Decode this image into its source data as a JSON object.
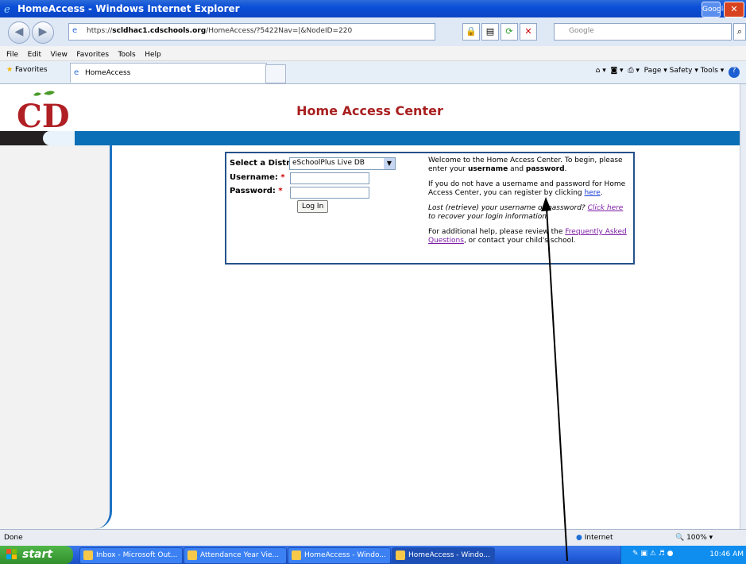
{
  "window": {
    "title": "HomeAccess - Windows Internet Explorer",
    "google_btn": "Google"
  },
  "addressbar": {
    "url_prefix": "https://",
    "url_host": "scldhac1.cdschools.org",
    "url_path": "/HomeAccess/?5422Nav=|&NodeID=220",
    "search_placeholder": "Google"
  },
  "menu": [
    "File",
    "Edit",
    "View",
    "Favorites",
    "Tools",
    "Help"
  ],
  "favorites_bar": {
    "favorites_label": "Favorites",
    "tab_title": "HomeAccess",
    "commands": "Page ▾   Safety ▾   Tools ▾"
  },
  "page": {
    "logo_text": "CD",
    "header_title": "Home Access Center",
    "login": {
      "district_label": "Select a District:",
      "district_value": "eSchoolPlus Live DB",
      "username_label": "Username:",
      "password_label": "Password:",
      "required_marker": "*",
      "login_button": "Log In"
    },
    "info": {
      "p1_a": "Welcome to the Home Access Center. To begin, please enter your ",
      "p1_username": "username",
      "p1_and": " and ",
      "p1_password": "password",
      "p1_end": ".",
      "p2_a": "If you do not have a username and password for Home Access Center, you can register by clicking ",
      "p2_link": "here",
      "p2_end": ".",
      "p3_a": "Lost (retrieve) your username or password? ",
      "p3_link": "Click here",
      "p3_end": " to recover your login information.",
      "p4_a": "For additional help, please review the ",
      "p4_link": "Frequently Asked Questions",
      "p4_end": ", or contact your child's school."
    }
  },
  "statusbar": {
    "status": "Done",
    "zone": "Internet",
    "zoom": "100%"
  },
  "taskbar": {
    "start": "start",
    "tasks": [
      "Inbox - Microsoft Out...",
      "Attendance Year Vie...",
      "HomeAccess - Windo...",
      "HomeAccess - Windo..."
    ],
    "clock": "10:46 AM"
  },
  "colors": {
    "accent_title": "#a81f1f",
    "banner_blue": "#0a6fb6",
    "panel_border": "#24528c"
  }
}
